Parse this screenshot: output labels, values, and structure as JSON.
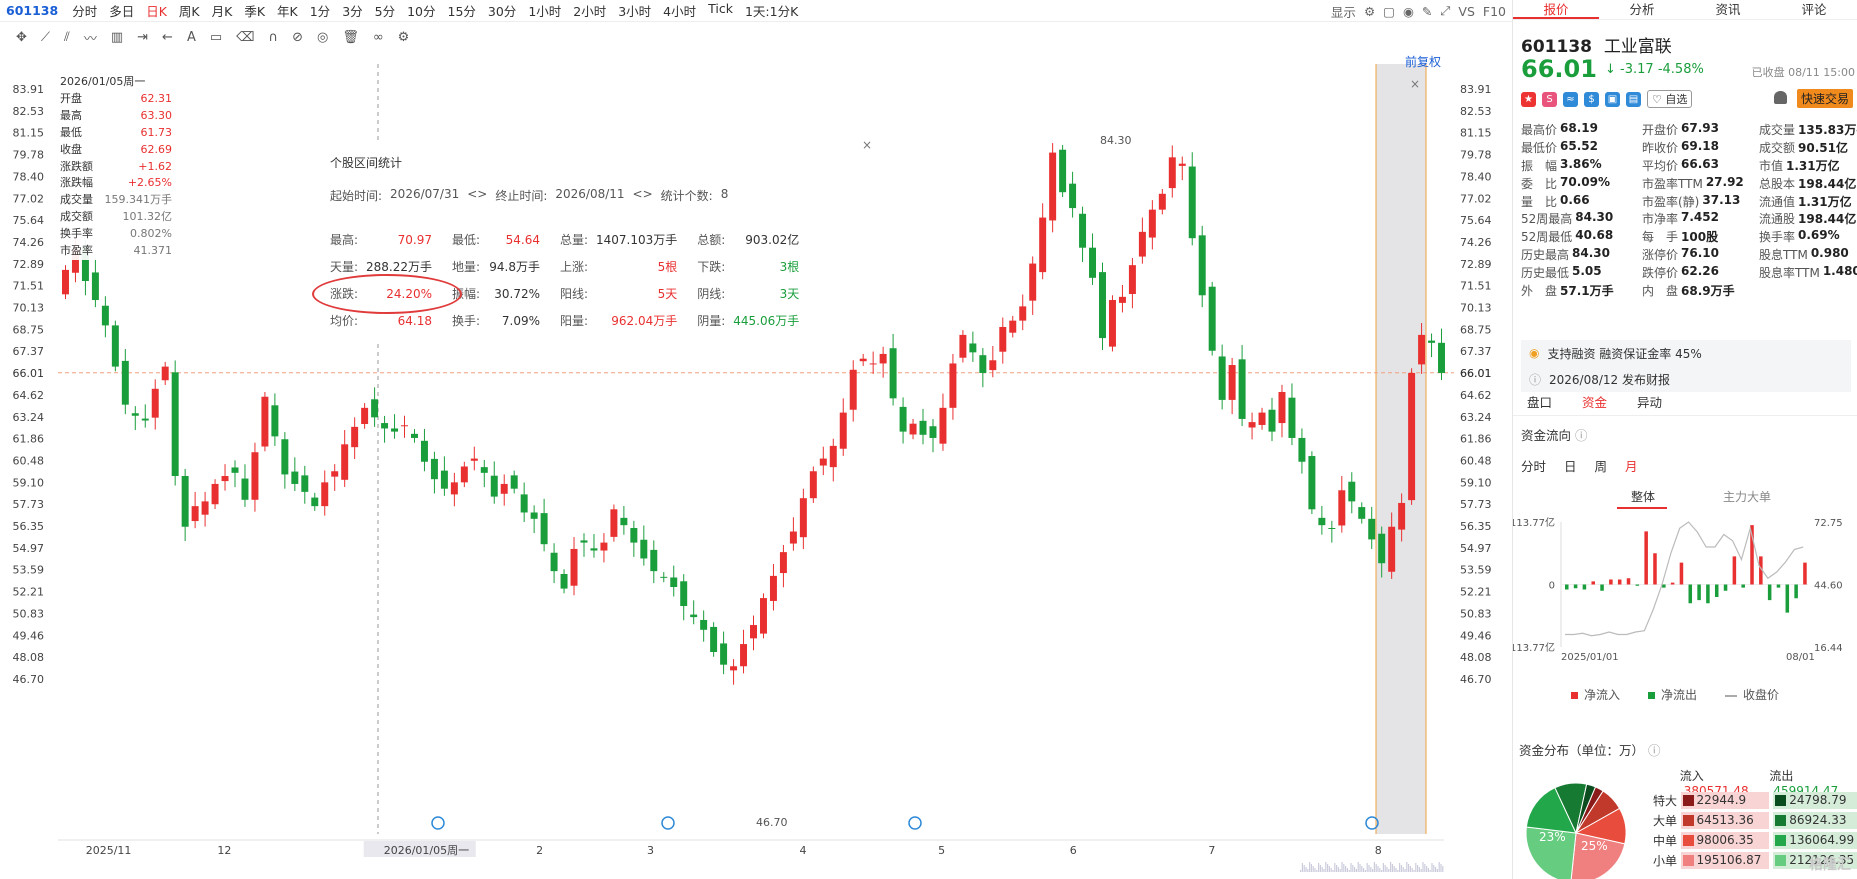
{
  "toolbar": {
    "code": "601138",
    "periods": [
      "分时",
      "多日",
      "日K",
      "周K",
      "月K",
      "季K",
      "年K",
      "1分",
      "3分",
      "5分",
      "10分",
      "15分",
      "30分",
      "1小时",
      "2小时",
      "3小时",
      "4小时",
      "Tick",
      "1天:1分K"
    ],
    "active_period": "日K",
    "right": {
      "display": "显示",
      "vs": "VS",
      "f10": "F10"
    }
  },
  "chart": {
    "fuquan": "前复权",
    "y_ticks": [
      83.91,
      82.53,
      81.15,
      79.78,
      78.4,
      77.02,
      75.64,
      74.26,
      72.89,
      71.51,
      70.13,
      68.75,
      67.37,
      66.01,
      64.62,
      63.24,
      61.86,
      60.48,
      59.1,
      57.73,
      56.35,
      54.97,
      53.59,
      52.21,
      50.83,
      49.46,
      48.08,
      46.7
    ],
    "current_price": "66.01",
    "high_label": "84.30",
    "low_label": "46.70",
    "x_labels": [
      {
        "label": "2025/11",
        "pos": 0.02
      },
      {
        "label": "12",
        "pos": 0.115
      },
      {
        "label": "2026/01/05周一",
        "pos": 0.235
      },
      {
        "label": "2",
        "pos": 0.345
      },
      {
        "label": "3",
        "pos": 0.425
      },
      {
        "label": "4",
        "pos": 0.535
      },
      {
        "label": "5",
        "pos": 0.635
      },
      {
        "label": "6",
        "pos": 0.73
      },
      {
        "label": "7",
        "pos": 0.83
      },
      {
        "label": "8",
        "pos": 0.95
      }
    ]
  },
  "ohlc": {
    "date": "2026/01/05周一",
    "rows": [
      {
        "k": "开盘",
        "v": "62.31",
        "c": "up"
      },
      {
        "k": "最高",
        "v": "63.30",
        "c": "up"
      },
      {
        "k": "最低",
        "v": "61.73",
        "c": "up"
      },
      {
        "k": "收盘",
        "v": "62.69",
        "c": "up"
      },
      {
        "k": "涨跌额",
        "v": "+1.62",
        "c": "up"
      },
      {
        "k": "涨跌幅",
        "v": "+2.65%",
        "c": "up"
      },
      {
        "k": "成交量",
        "v": "159.341万手",
        "c": "muted"
      },
      {
        "k": "成交额",
        "v": "101.32亿",
        "c": "muted"
      },
      {
        "k": "换手率",
        "v": "0.802%",
        "c": "muted"
      },
      {
        "k": "市盈率",
        "v": "41.371",
        "c": "muted"
      }
    ]
  },
  "stats": {
    "title": "个股区间统计",
    "start_label": "起始时间:",
    "start": "2026/07/31",
    "end_label": "终止时间:",
    "end": "2026/08/11",
    "count_label": "统计个数:",
    "count": "8",
    "rows": [
      [
        {
          "k": "最高:",
          "v": "70.97",
          "c": "up"
        },
        {
          "k": "最低:",
          "v": "54.64",
          "c": "up"
        },
        {
          "k": "总量:",
          "v": "1407.103万手",
          "c": ""
        },
        {
          "k": "总额:",
          "v": "903.02亿",
          "c": ""
        }
      ],
      [
        {
          "k": "天量:",
          "v": "288.22万手",
          "c": ""
        },
        {
          "k": "地量:",
          "v": "94.8万手",
          "c": ""
        },
        {
          "k": "上涨:",
          "v": "5根",
          "c": "up"
        },
        {
          "k": "下跌:",
          "v": "3根",
          "c": "down"
        }
      ],
      [
        {
          "k": "涨跌:",
          "v": "24.20%",
          "c": "up"
        },
        {
          "k": "振幅:",
          "v": "30.72%",
          "c": ""
        },
        {
          "k": "阳线:",
          "v": "5天",
          "c": "up"
        },
        {
          "k": "阴线:",
          "v": "3天",
          "c": "down"
        }
      ],
      [
        {
          "k": "均价:",
          "v": "64.18",
          "c": "up"
        },
        {
          "k": "换手:",
          "v": "7.09%",
          "c": ""
        },
        {
          "k": "阳量:",
          "v": "962.04万手",
          "c": "up"
        },
        {
          "k": "阴量:",
          "v": "445.06万手",
          "c": "down"
        }
      ]
    ]
  },
  "panel": {
    "tabs": [
      "报价",
      "分析",
      "资讯",
      "评论"
    ],
    "code": "601138",
    "name": "工业富联",
    "price": "66.01",
    "change": "-3.17",
    "change_pct": "-4.58%",
    "close_time": "已收盘 08/11 15:00",
    "watch": "自选",
    "quick_trade": "快速交易",
    "quote": [
      [
        {
          "k": "最高价",
          "v": "68.19",
          "c": "up"
        },
        {
          "k": "开盘价",
          "v": "67.93",
          "c": "down"
        },
        {
          "k": "成交量",
          "v": "135.83万手",
          "c": ""
        }
      ],
      [
        {
          "k": "最低价",
          "v": "65.52",
          "c": "down"
        },
        {
          "k": "昨收价",
          "v": "69.18",
          "c": ""
        },
        {
          "k": "成交额",
          "v": "90.51亿",
          "c": ""
        }
      ],
      [
        {
          "k": "振　幅",
          "v": "3.86%",
          "c": ""
        },
        {
          "k": "平均价",
          "v": "66.63",
          "c": "down"
        },
        {
          "k": "市值",
          "v": "1.31万亿",
          "c": ""
        }
      ],
      [
        {
          "k": "委　比",
          "v": "70.09%",
          "c": ""
        },
        {
          "k": "市盈率TTM",
          "v": "27.92",
          "c": ""
        },
        {
          "k": "总股本",
          "v": "198.44亿",
          "c": ""
        }
      ],
      [
        {
          "k": "量　比",
          "v": "0.66",
          "c": ""
        },
        {
          "k": "市盈率(静)",
          "v": "37.13",
          "c": ""
        },
        {
          "k": "流通值",
          "v": "1.31万亿",
          "c": ""
        }
      ],
      [
        {
          "k": "52周最高",
          "v": "84.30",
          "c": "up"
        },
        {
          "k": "市净率",
          "v": "7.452",
          "c": ""
        },
        {
          "k": "流通股",
          "v": "198.44亿",
          "c": ""
        }
      ],
      [
        {
          "k": "52周最低",
          "v": "40.68",
          "c": "down"
        },
        {
          "k": "每　手",
          "v": "100股",
          "c": ""
        },
        {
          "k": "换手率",
          "v": "0.69%",
          "c": ""
        }
      ],
      [
        {
          "k": "历史最高",
          "v": "84.30",
          "c": "up"
        },
        {
          "k": "涨停价",
          "v": "76.10",
          "c": "up"
        },
        {
          "k": "股息TTM",
          "v": "0.980",
          "c": ""
        }
      ],
      [
        {
          "k": "历史最低",
          "v": "5.05",
          "c": "down"
        },
        {
          "k": "跌停价",
          "v": "62.26",
          "c": "down"
        },
        {
          "k": "股息率TTM",
          "v": "1.480%",
          "c": ""
        }
      ],
      [
        {
          "k": "外　盘",
          "v": "57.1万手",
          "c": "up"
        },
        {
          "k": "内　盘",
          "v": "68.9万手",
          "c": "down"
        },
        {
          "k": "",
          "v": "",
          "c": ""
        }
      ]
    ],
    "notice1": "支持融资 融资保证金率 45%",
    "notice2": "2026/08/12  发布财报",
    "subtabs": [
      "盘口",
      "资金",
      "异动"
    ],
    "fund_title": "资金流向",
    "periods": [
      "分时",
      "日",
      "周",
      "月"
    ],
    "ztab": "整体",
    "zltab": "主力大单",
    "fund_chart": {
      "y_left": [
        "113.77亿",
        "0",
        "-113.77亿"
      ],
      "y_right": [
        "72.75",
        "44.60",
        "16.44"
      ],
      "x": [
        "2025/01/01",
        "08/01"
      ],
      "bars": [
        -0.08,
        -0.06,
        -0.08,
        0.05,
        -0.1,
        0.08,
        0.08,
        0.1,
        -0.02,
        0.85,
        0.5,
        -0.05,
        0.03,
        0.35,
        -0.3,
        -0.25,
        -0.3,
        -0.2,
        -0.1,
        0.45,
        -0.05,
        0.95,
        0.45,
        -0.25,
        -0.05,
        -0.45,
        -0.22,
        0.35
      ],
      "price": [
        0.1,
        0.1,
        0.11,
        0.09,
        0.1,
        0.12,
        0.1,
        0.1,
        0.12,
        0.13,
        0.3,
        0.5,
        0.75,
        0.95,
        1.0,
        0.92,
        0.8,
        0.8,
        0.9,
        0.85,
        0.7,
        0.95,
        0.65,
        0.55,
        0.6,
        0.68,
        0.78,
        0.8
      ]
    },
    "legend": [
      "净流入",
      "净流出",
      "收盘价"
    ],
    "dist_title": "资金分布（单位：万）",
    "dist": {
      "in_label": "流入",
      "in_total": "380571.48",
      "out_label": "流出",
      "out_total": "459914.47",
      "rows": [
        {
          "lbl": "特大",
          "in": "22944.9",
          "out": "24798.79"
        },
        {
          "lbl": "大单",
          "in": "64513.36",
          "out": "86924.33"
        },
        {
          "lbl": "中单",
          "in": "98006.35",
          "out": "136064.99"
        },
        {
          "lbl": "小单",
          "in": "195106.87",
          "out": "212126.35"
        }
      ],
      "pie_in_pct": "23%",
      "pie_out_pct": "25%"
    },
    "logo": "格隆汇"
  }
}
